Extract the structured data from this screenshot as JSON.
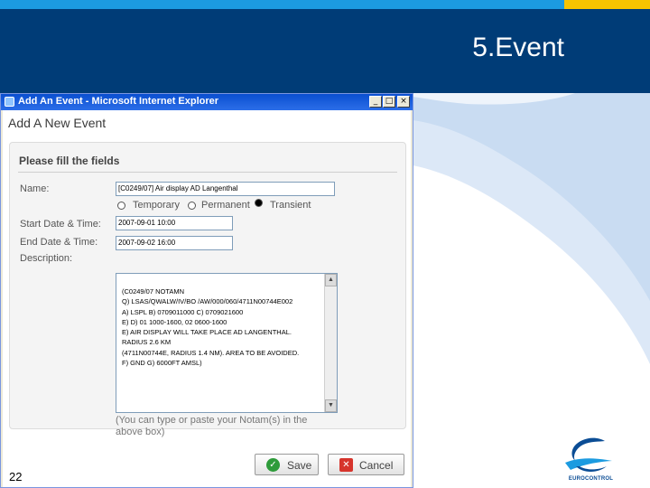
{
  "slide": {
    "title": "5.Event",
    "number": "22",
    "logo_text": "EUROCONTROL"
  },
  "colors": {
    "header": "#003c77",
    "top_stripe": "#1c9be0",
    "accent": "#f7c400"
  },
  "window": {
    "title": "Add An Event - Microsoft Internet Explorer",
    "controls": [
      "minimize-icon",
      "maximize-icon",
      "close-icon"
    ]
  },
  "page": {
    "heading": "Add A New Event"
  },
  "form": {
    "heading": "Please fill the fields",
    "name_label": "Name:",
    "name_value": "[C0249/07] Air display AD Langenthal",
    "radio_options": [
      {
        "label": "Temporary",
        "checked": false
      },
      {
        "label": "Permanent",
        "checked": false
      },
      {
        "label": "Transient",
        "checked": true
      }
    ],
    "start_label": "Start Date & Time:",
    "start_value": "2007-09-01 10:00",
    "end_label": "End Date & Time:",
    "end_value": "2007-09-02 16:00",
    "description_label": "Description:",
    "description_value": "(C0249/07 NOTAMN\nQ) LSAS/QWALW/IV/BO /AW/000/060/4711N00744E002\nA) LSPL B) 0709011000 C) 0709021600\nE) D) 01 1000-1600, 02 0600-1600\nE) AIR DISPLAY WILL TAKE PLACE AD LANGENTHAL.\nRADIUS 2.6 KM\n(4711N00744E, RADIUS 1.4 NM). AREA TO BE AVOIDED.\nF) GND G) 6000FT AMSL)",
    "hint": "(You can type or paste your Notam(s) in the above box)"
  },
  "buttons": {
    "save_label": "Save",
    "cancel_label": "Cancel"
  }
}
